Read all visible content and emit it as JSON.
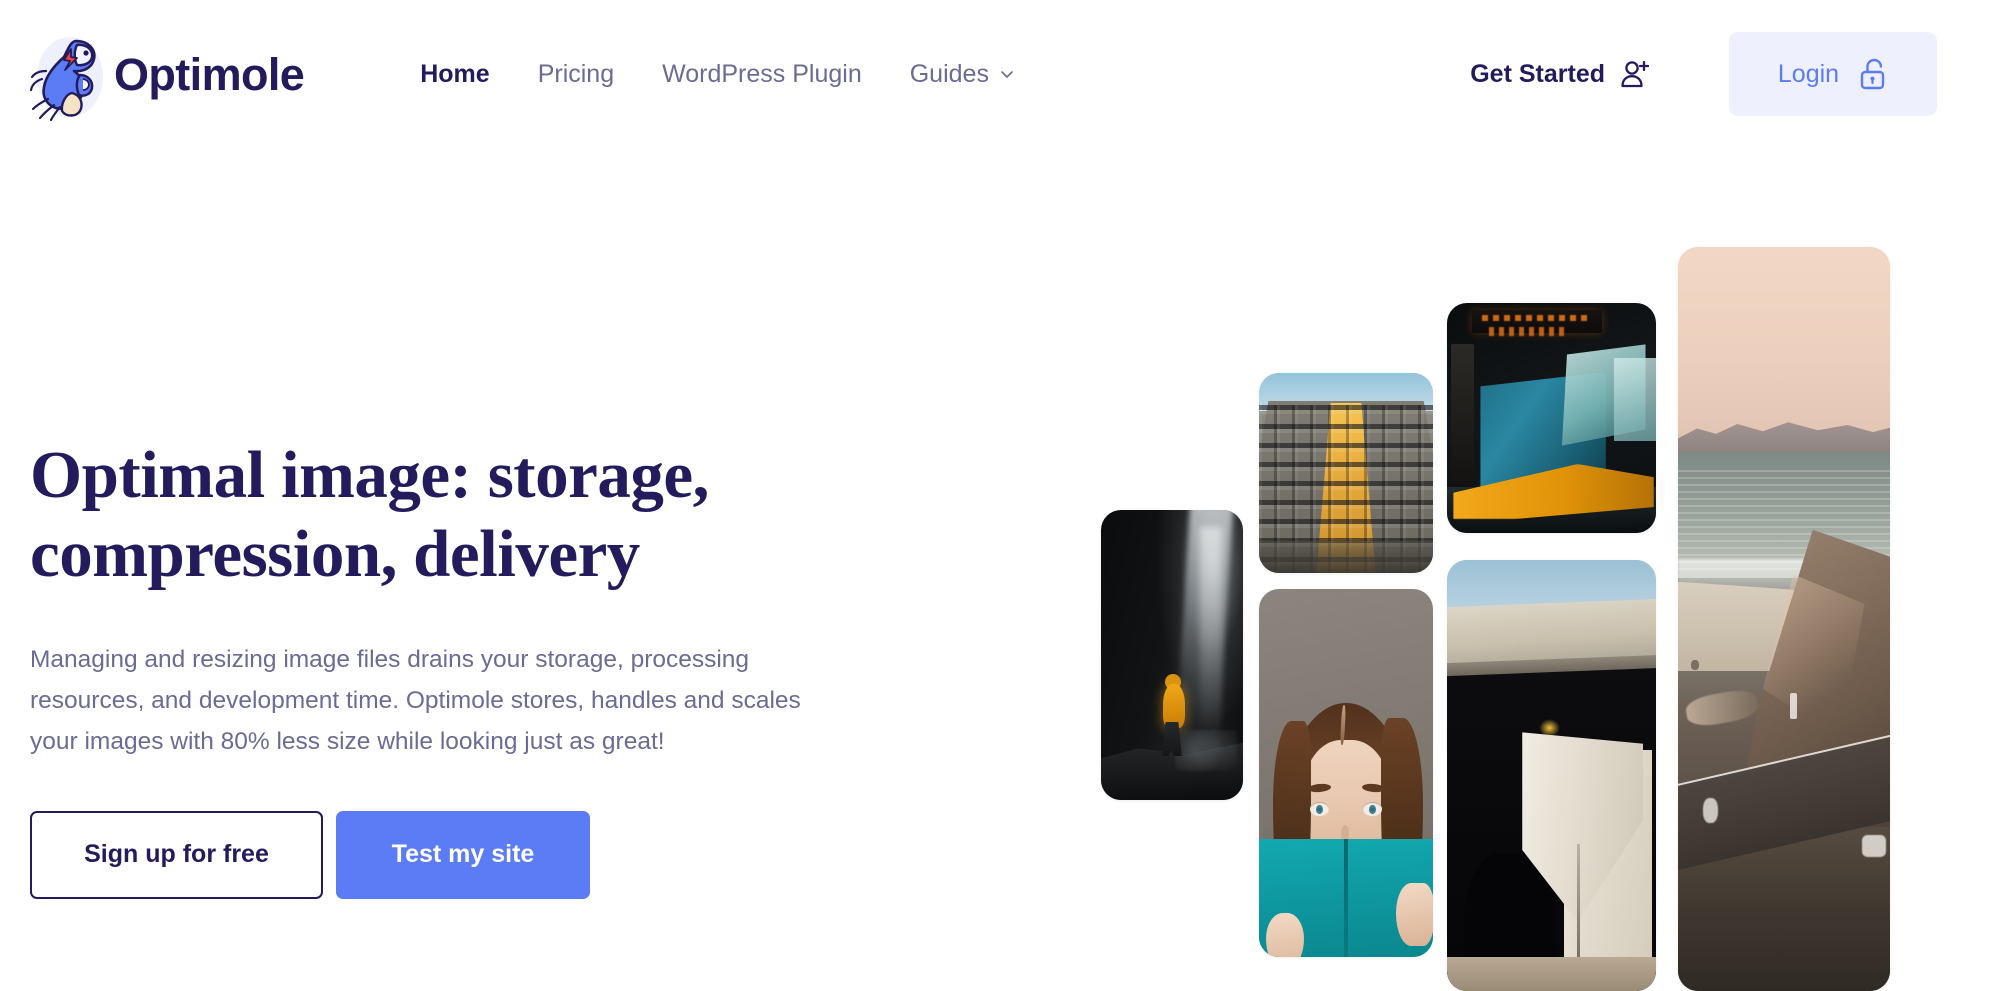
{
  "brand": {
    "name": "Optimole",
    "logo_icon": "mole-mascot-logo",
    "brand_navy": "#231b5c",
    "accent_blue": "#5b7cf5",
    "login_bg": "#eef0fe"
  },
  "nav": {
    "items": [
      {
        "label": "Home",
        "active": true,
        "has_dropdown": false
      },
      {
        "label": "Pricing",
        "active": false,
        "has_dropdown": false
      },
      {
        "label": "WordPress Plugin",
        "active": false,
        "has_dropdown": false
      },
      {
        "label": "Guides",
        "active": false,
        "has_dropdown": true
      }
    ],
    "dropdown_icon": "chevron-down-icon"
  },
  "header_actions": {
    "get_started_label": "Get Started",
    "get_started_icon": "user-plus-icon",
    "login_label": "Login",
    "login_icon": "unlocked-padlock-icon"
  },
  "hero": {
    "headline_line1": "Optimal image: storage,",
    "headline_line2": "compression, delivery",
    "paragraph": "Managing and resizing image files drains your storage, processing resources, and development time. Optimole stores, handles and scales your images with 80% less size while looking just as great!",
    "primary_cta": "Test my site",
    "secondary_cta": "Sign up for free"
  },
  "collage": {
    "images": [
      {
        "name": "waterfall-cave-hiker",
        "alt": "Hiker in yellow jacket beside a waterfall in a dark cave"
      },
      {
        "name": "building-upward-perspective",
        "alt": "Upward view of a tall building facade with golden sunlit stripe"
      },
      {
        "name": "train-station-platform",
        "alt": "Blue and yellow tram at a station platform with orange destination sign"
      },
      {
        "name": "woman-with-teal-book",
        "alt": "Woman with brown hair holding a teal book over the lower half of her face"
      },
      {
        "name": "concrete-bridge-underpass",
        "alt": "Concrete highway overpass against a blue sky with dark underpass"
      },
      {
        "name": "coastal-beach-sunset",
        "alt": "Coastal cliffs, beach and railway at golden hour"
      }
    ]
  }
}
